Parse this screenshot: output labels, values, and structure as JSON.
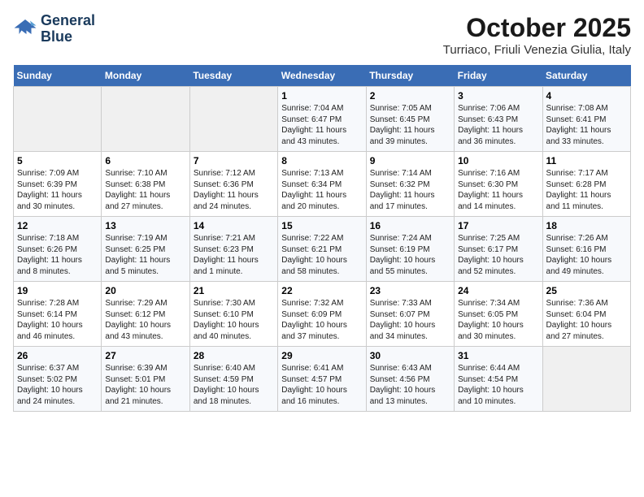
{
  "header": {
    "logo_line1": "General",
    "logo_line2": "Blue",
    "month": "October 2025",
    "location": "Turriaco, Friuli Venezia Giulia, Italy"
  },
  "days_of_week": [
    "Sunday",
    "Monday",
    "Tuesday",
    "Wednesday",
    "Thursday",
    "Friday",
    "Saturday"
  ],
  "weeks": [
    [
      {
        "day": "",
        "info": ""
      },
      {
        "day": "",
        "info": ""
      },
      {
        "day": "",
        "info": ""
      },
      {
        "day": "1",
        "info": "Sunrise: 7:04 AM\nSunset: 6:47 PM\nDaylight: 11 hours\nand 43 minutes."
      },
      {
        "day": "2",
        "info": "Sunrise: 7:05 AM\nSunset: 6:45 PM\nDaylight: 11 hours\nand 39 minutes."
      },
      {
        "day": "3",
        "info": "Sunrise: 7:06 AM\nSunset: 6:43 PM\nDaylight: 11 hours\nand 36 minutes."
      },
      {
        "day": "4",
        "info": "Sunrise: 7:08 AM\nSunset: 6:41 PM\nDaylight: 11 hours\nand 33 minutes."
      }
    ],
    [
      {
        "day": "5",
        "info": "Sunrise: 7:09 AM\nSunset: 6:39 PM\nDaylight: 11 hours\nand 30 minutes."
      },
      {
        "day": "6",
        "info": "Sunrise: 7:10 AM\nSunset: 6:38 PM\nDaylight: 11 hours\nand 27 minutes."
      },
      {
        "day": "7",
        "info": "Sunrise: 7:12 AM\nSunset: 6:36 PM\nDaylight: 11 hours\nand 24 minutes."
      },
      {
        "day": "8",
        "info": "Sunrise: 7:13 AM\nSunset: 6:34 PM\nDaylight: 11 hours\nand 20 minutes."
      },
      {
        "day": "9",
        "info": "Sunrise: 7:14 AM\nSunset: 6:32 PM\nDaylight: 11 hours\nand 17 minutes."
      },
      {
        "day": "10",
        "info": "Sunrise: 7:16 AM\nSunset: 6:30 PM\nDaylight: 11 hours\nand 14 minutes."
      },
      {
        "day": "11",
        "info": "Sunrise: 7:17 AM\nSunset: 6:28 PM\nDaylight: 11 hours\nand 11 minutes."
      }
    ],
    [
      {
        "day": "12",
        "info": "Sunrise: 7:18 AM\nSunset: 6:26 PM\nDaylight: 11 hours\nand 8 minutes."
      },
      {
        "day": "13",
        "info": "Sunrise: 7:19 AM\nSunset: 6:25 PM\nDaylight: 11 hours\nand 5 minutes."
      },
      {
        "day": "14",
        "info": "Sunrise: 7:21 AM\nSunset: 6:23 PM\nDaylight: 11 hours\nand 1 minute."
      },
      {
        "day": "15",
        "info": "Sunrise: 7:22 AM\nSunset: 6:21 PM\nDaylight: 10 hours\nand 58 minutes."
      },
      {
        "day": "16",
        "info": "Sunrise: 7:24 AM\nSunset: 6:19 PM\nDaylight: 10 hours\nand 55 minutes."
      },
      {
        "day": "17",
        "info": "Sunrise: 7:25 AM\nSunset: 6:17 PM\nDaylight: 10 hours\nand 52 minutes."
      },
      {
        "day": "18",
        "info": "Sunrise: 7:26 AM\nSunset: 6:16 PM\nDaylight: 10 hours\nand 49 minutes."
      }
    ],
    [
      {
        "day": "19",
        "info": "Sunrise: 7:28 AM\nSunset: 6:14 PM\nDaylight: 10 hours\nand 46 minutes."
      },
      {
        "day": "20",
        "info": "Sunrise: 7:29 AM\nSunset: 6:12 PM\nDaylight: 10 hours\nand 43 minutes."
      },
      {
        "day": "21",
        "info": "Sunrise: 7:30 AM\nSunset: 6:10 PM\nDaylight: 10 hours\nand 40 minutes."
      },
      {
        "day": "22",
        "info": "Sunrise: 7:32 AM\nSunset: 6:09 PM\nDaylight: 10 hours\nand 37 minutes."
      },
      {
        "day": "23",
        "info": "Sunrise: 7:33 AM\nSunset: 6:07 PM\nDaylight: 10 hours\nand 34 minutes."
      },
      {
        "day": "24",
        "info": "Sunrise: 7:34 AM\nSunset: 6:05 PM\nDaylight: 10 hours\nand 30 minutes."
      },
      {
        "day": "25",
        "info": "Sunrise: 7:36 AM\nSunset: 6:04 PM\nDaylight: 10 hours\nand 27 minutes."
      }
    ],
    [
      {
        "day": "26",
        "info": "Sunrise: 6:37 AM\nSunset: 5:02 PM\nDaylight: 10 hours\nand 24 minutes."
      },
      {
        "day": "27",
        "info": "Sunrise: 6:39 AM\nSunset: 5:01 PM\nDaylight: 10 hours\nand 21 minutes."
      },
      {
        "day": "28",
        "info": "Sunrise: 6:40 AM\nSunset: 4:59 PM\nDaylight: 10 hours\nand 18 minutes."
      },
      {
        "day": "29",
        "info": "Sunrise: 6:41 AM\nSunset: 4:57 PM\nDaylight: 10 hours\nand 16 minutes."
      },
      {
        "day": "30",
        "info": "Sunrise: 6:43 AM\nSunset: 4:56 PM\nDaylight: 10 hours\nand 13 minutes."
      },
      {
        "day": "31",
        "info": "Sunrise: 6:44 AM\nSunset: 4:54 PM\nDaylight: 10 hours\nand 10 minutes."
      },
      {
        "day": "",
        "info": ""
      }
    ]
  ]
}
